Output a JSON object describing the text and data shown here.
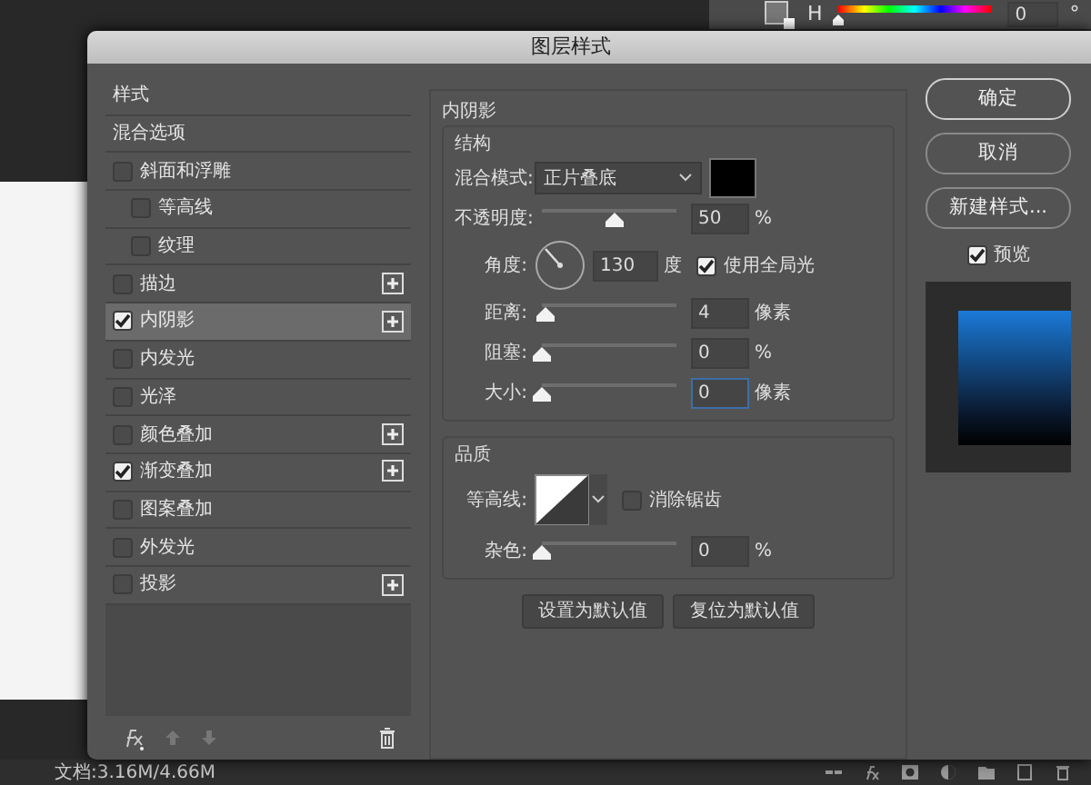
{
  "app": {
    "color_panel": {
      "label": "H",
      "level": 0,
      "value": "0",
      "unit": "°"
    },
    "status_bar": "文档:3.16M/4.66M"
  },
  "dialog": {
    "title": "图层样式",
    "sidebar": {
      "items": [
        {
          "label": "样式",
          "kind": "header",
          "selected": false
        },
        {
          "label": "混合选项",
          "kind": "header",
          "selected": false
        },
        {
          "label": "斜面和浮雕",
          "kind": "option",
          "checked": false,
          "selected": false,
          "add": false,
          "children": [
            {
              "label": "等高线",
              "kind": "option",
              "checked": false,
              "selected": false,
              "add": false
            },
            {
              "label": "纹理",
              "kind": "option",
              "checked": false,
              "selected": false,
              "add": false
            }
          ]
        },
        {
          "label": "描边",
          "kind": "option",
          "checked": false,
          "selected": false,
          "add": true
        },
        {
          "label": "内阴影",
          "kind": "option",
          "checked": true,
          "selected": true,
          "add": true
        },
        {
          "label": "内发光",
          "kind": "option",
          "checked": false,
          "selected": false,
          "add": false
        },
        {
          "label": "光泽",
          "kind": "option",
          "checked": false,
          "selected": false,
          "add": false
        },
        {
          "label": "颜色叠加",
          "kind": "option",
          "checked": false,
          "selected": false,
          "add": true
        },
        {
          "label": "渐变叠加",
          "kind": "option",
          "checked": true,
          "selected": false,
          "add": true
        },
        {
          "label": "图案叠加",
          "kind": "option",
          "checked": false,
          "selected": false,
          "add": false
        },
        {
          "label": "外发光",
          "kind": "option",
          "checked": false,
          "selected": false,
          "add": false
        },
        {
          "label": "投影",
          "kind": "option",
          "checked": false,
          "selected": false,
          "add": true
        }
      ]
    },
    "panel": {
      "title": "内阴影",
      "structure": {
        "title": "结构",
        "rows": [
          {
            "kind": "select",
            "label": "混合模式:",
            "value": "正片叠底",
            "color": "#000000"
          },
          {
            "kind": "slider",
            "label": "不透明度:",
            "level": 0.5,
            "value": "50",
            "unit": "%",
            "focused": false
          },
          {
            "kind": "angle",
            "label": "角度:",
            "value": "130",
            "unit": "度",
            "checkbox": {
              "label": "使用全局光",
              "checked": true
            }
          },
          {
            "kind": "slider",
            "label": "距离:",
            "level": 0.02,
            "value": "4",
            "unit": "像素",
            "focused": false
          },
          {
            "kind": "slider",
            "label": "阻塞:",
            "level": 0,
            "value": "0",
            "unit": "%",
            "focused": false
          },
          {
            "kind": "slider",
            "label": "大小:",
            "level": 0,
            "value": "0",
            "unit": "像素",
            "focused": true
          }
        ]
      },
      "quality": {
        "title": "品质",
        "rows": [
          {
            "kind": "contour",
            "label": "等高线:",
            "checkbox": {
              "label": "消除锯齿",
              "checked": false
            }
          },
          {
            "kind": "slider",
            "label": "杂色:",
            "level": 0,
            "value": "0",
            "unit": "%",
            "focused": false
          }
        ]
      },
      "buttons": [
        "设置为默认值",
        "复位为默认值"
      ]
    },
    "actions": {
      "buttons": [
        "确定",
        "取消",
        "新建样式..."
      ],
      "preview": {
        "label": "预览",
        "checked": true
      }
    }
  }
}
